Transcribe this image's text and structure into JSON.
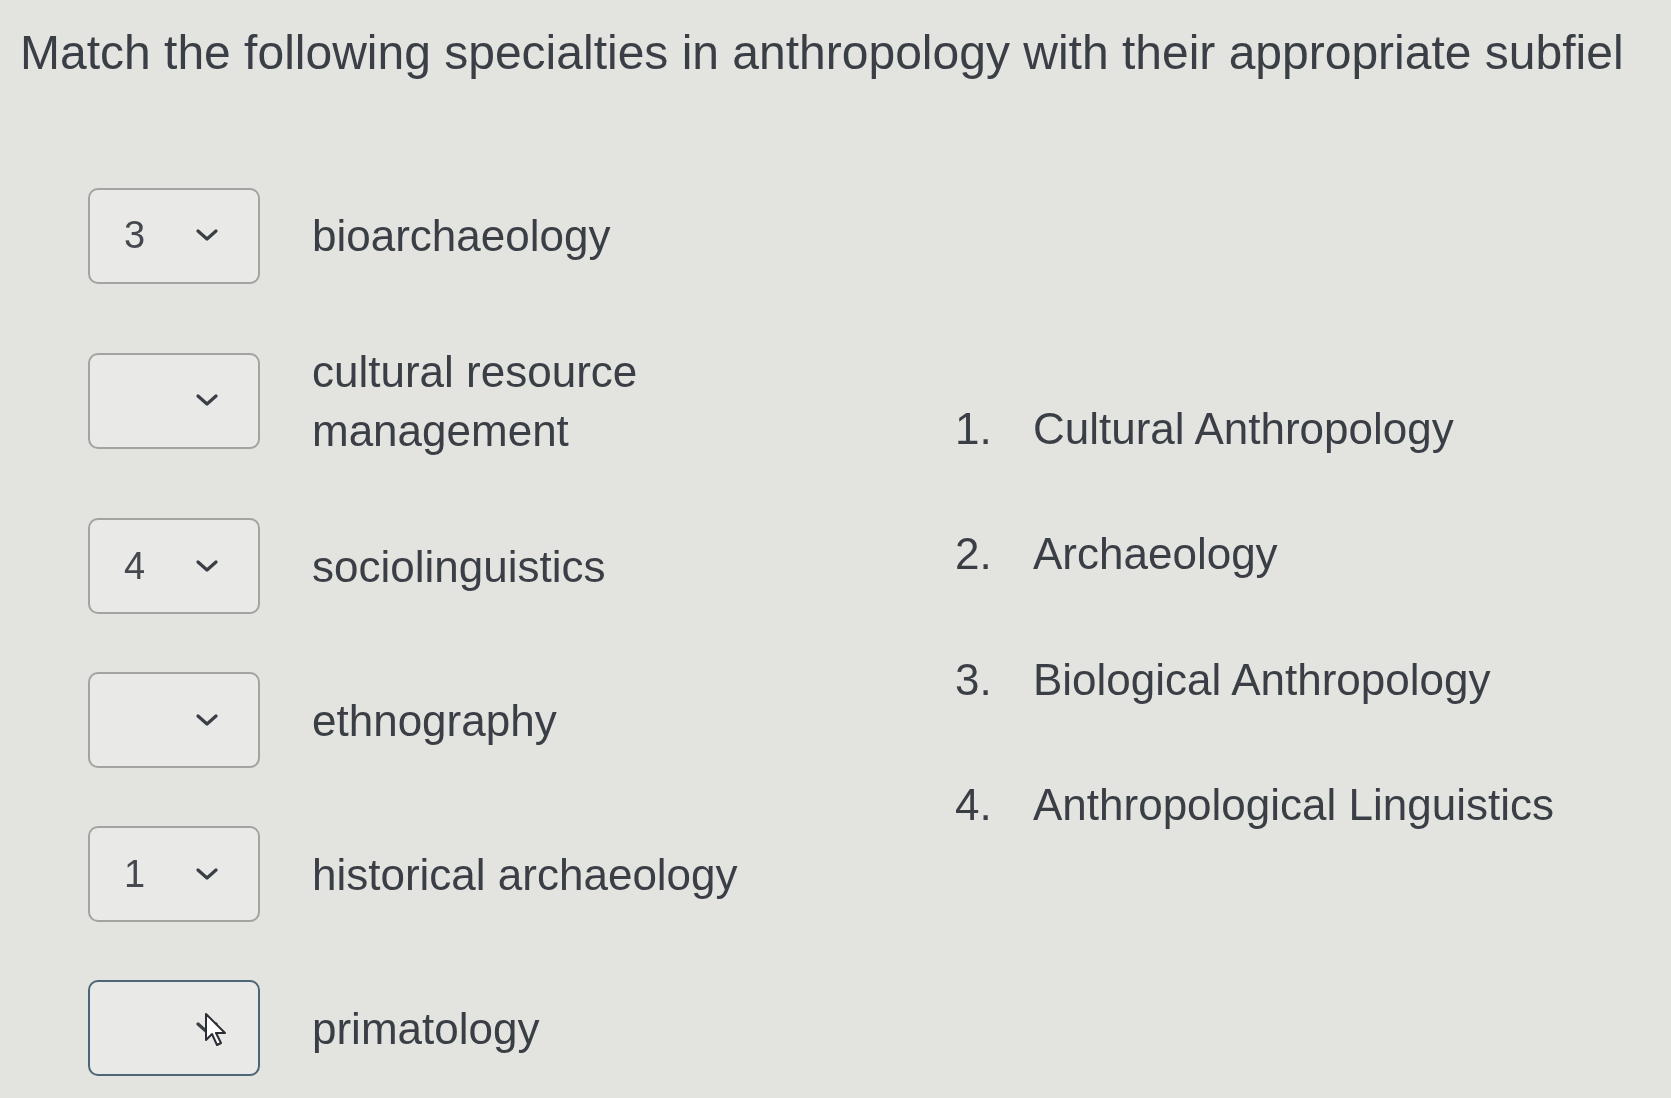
{
  "question": {
    "prompt": "Match the following specialties in anthropology with their appropriate subfiel"
  },
  "matches": [
    {
      "answer": "3",
      "specialty": "bioarchaeology",
      "hovered": false
    },
    {
      "specialty": "cultural resource management",
      "hovered": false
    },
    {
      "answer": "4",
      "specialty": "sociolinguistics",
      "hovered": false
    },
    {
      "specialty": "ethnography",
      "hovered": false
    },
    {
      "answer": "1",
      "specialty": "historical archaeology",
      "hovered": false
    },
    {
      "specialty": "primatology",
      "hovered": true
    }
  ],
  "options": [
    {
      "number": "1.",
      "label": "Cultural Anthropology"
    },
    {
      "number": "2.",
      "label": "Archaeology"
    },
    {
      "number": "3.",
      "label": "Biological Anthropology"
    },
    {
      "number": "4.",
      "label": "Anthropological Linguistics"
    }
  ]
}
